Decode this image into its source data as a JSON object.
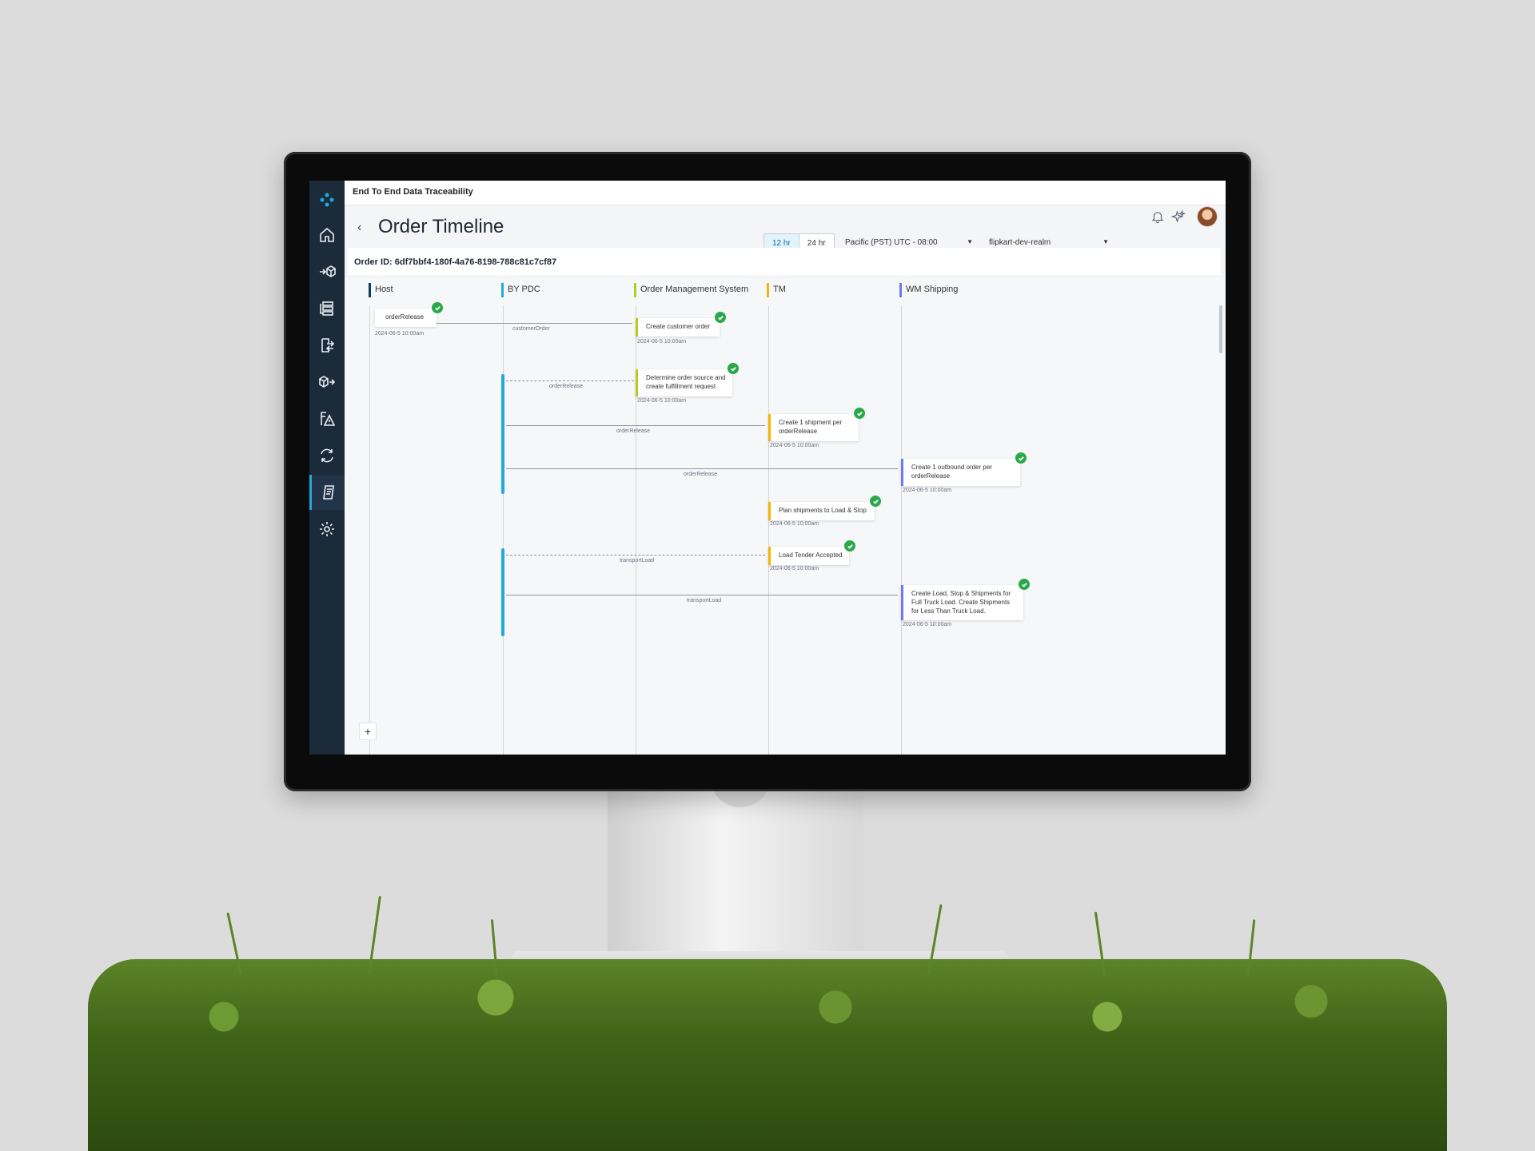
{
  "app": {
    "title": "End To End Data Traceability"
  },
  "header": {
    "title": "Order Timeline",
    "range_12": "12 hr",
    "range_24": "24 hr",
    "timezone": "Pacific (PST) UTC - 08:00",
    "realm": "flipkart-dev-realm"
  },
  "order": {
    "id_label": "Order ID: 6df7bbf4-180f-4a76-8198-788c81c7cf87"
  },
  "colors": {
    "host": "#0d3b66",
    "bypdc": "#1eaadf",
    "oms": "#b9cc1e",
    "tm": "#f5b400",
    "wm": "#6c7cf0",
    "check": "#2aa94a"
  },
  "lanes": [
    {
      "name": "Host"
    },
    {
      "name": "BY PDC"
    },
    {
      "name": "Order Management System"
    },
    {
      "name": "TM"
    },
    {
      "name": "WM Shipping"
    }
  ],
  "cards": [
    {
      "text": "orderRelease",
      "ts": "2024-06-5 10:00am"
    },
    {
      "text": "Create customer order",
      "ts": "2024-06-5 10:00am"
    },
    {
      "text": "Determine order source and create fulfillment request",
      "ts": "2024-06-5 10:00am"
    },
    {
      "text": "Create 1 shipment per orderRelease",
      "ts": "2024-06-5 10:00am"
    },
    {
      "text": "Create 1 outbound order per orderRelease",
      "ts": "2024-06-5 10:00am"
    },
    {
      "text": "Plan shipments to Load & Stop",
      "ts": "2024-06-5 10:00am"
    },
    {
      "text": "Load Tender Accepted",
      "ts": "2024-06-5 10:00am"
    },
    {
      "text": "Create Load, Stop & Shipments for Full Truck Load. Create Shipments for Less Than Truck Load.",
      "ts": "2024-06-5 10:00am"
    }
  ],
  "messages": [
    {
      "label": "customerOrder"
    },
    {
      "label": "orderRelease"
    },
    {
      "label": "orderRelease"
    },
    {
      "label": "orderRelease"
    },
    {
      "label": "transportLoad"
    },
    {
      "label": "transportLoad"
    }
  ],
  "icons": {
    "sidebar": [
      "logo-icon",
      "home-icon",
      "inbound-box-icon",
      "list-flow-icon",
      "transfer-icon",
      "outbound-box-icon",
      "alert-doc-icon",
      "sync-icon",
      "document-icon",
      "settings-icon"
    ]
  }
}
